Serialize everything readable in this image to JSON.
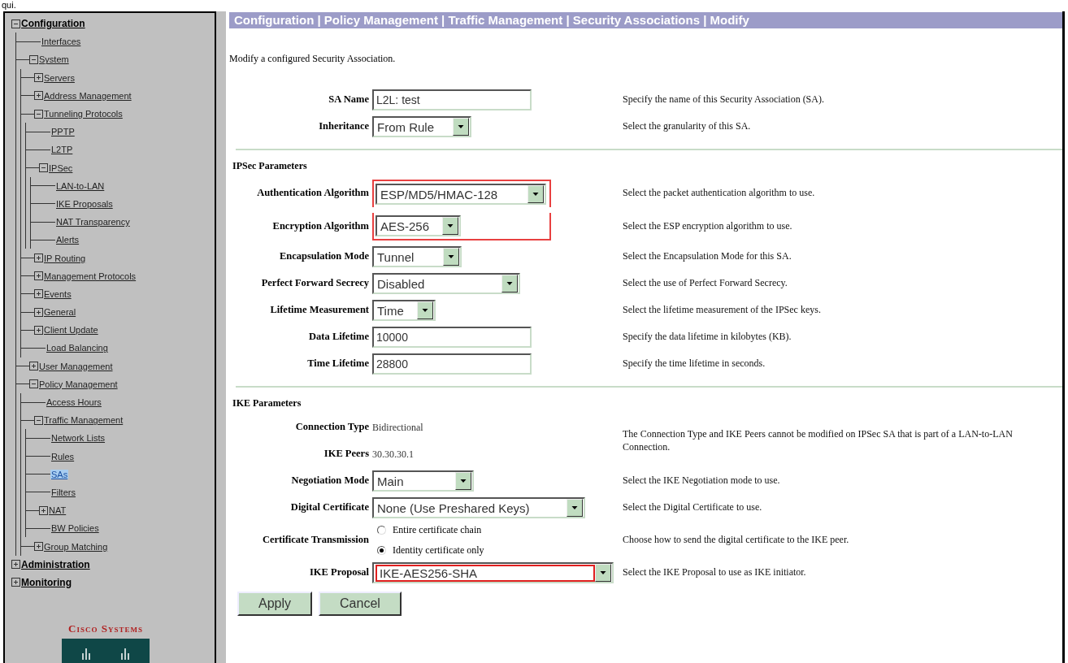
{
  "top_fragment": "qui.",
  "tree": [
    {
      "label": "Configuration",
      "expanded": true,
      "selected": false,
      "children": [
        {
          "label": "Interfaces",
          "selected": false
        },
        {
          "label": "System",
          "expanded": true,
          "selected": false,
          "children": [
            {
              "label": "Servers",
              "expanded": false,
              "selected": false
            },
            {
              "label": "Address Management",
              "expanded": false,
              "selected": false
            },
            {
              "label": "Tunneling Protocols",
              "expanded": true,
              "selected": false,
              "children": [
                {
                  "label": "PPTP",
                  "selected": false
                },
                {
                  "label": "L2TP",
                  "selected": false
                },
                {
                  "label": "IPSec",
                  "expanded": true,
                  "selected": false,
                  "children": [
                    {
                      "label": "LAN-to-LAN",
                      "selected": false
                    },
                    {
                      "label": "IKE Proposals",
                      "selected": false
                    },
                    {
                      "label": "NAT Transparency",
                      "selected": false
                    },
                    {
                      "label": "Alerts",
                      "selected": false
                    }
                  ]
                }
              ]
            },
            {
              "label": "IP Routing",
              "expanded": false,
              "selected": false
            },
            {
              "label": "Management Protocols",
              "expanded": false,
              "selected": false
            },
            {
              "label": "Events",
              "expanded": false,
              "selected": false
            },
            {
              "label": "General",
              "expanded": false,
              "selected": false
            },
            {
              "label": "Client Update",
              "expanded": false,
              "selected": false
            },
            {
              "label": "Load Balancing",
              "selected": false
            }
          ]
        },
        {
          "label": "User Management",
          "expanded": false,
          "selected": false
        },
        {
          "label": "Policy Management",
          "expanded": true,
          "selected": false,
          "children": [
            {
              "label": "Access Hours",
              "selected": false
            },
            {
              "label": "Traffic Management",
              "expanded": true,
              "selected": false,
              "children": [
                {
                  "label": "Network Lists",
                  "selected": false
                },
                {
                  "label": "Rules",
                  "selected": false
                },
                {
                  "label": "SAs",
                  "selected": true
                },
                {
                  "label": "Filters",
                  "selected": false
                },
                {
                  "label": "NAT",
                  "expanded": false,
                  "selected": false
                },
                {
                  "label": "BW Policies",
                  "selected": false
                }
              ]
            },
            {
              "label": "Group Matching",
              "expanded": false,
              "selected": false
            }
          ]
        }
      ]
    },
    {
      "label": "Administration",
      "expanded": false,
      "selected": false
    },
    {
      "label": "Monitoring",
      "expanded": false,
      "selected": false
    }
  ],
  "logo": {
    "text": "Cisco Systems"
  },
  "breadcrumb": "Configuration | Policy Management | Traffic Management | Security Associations | Modify",
  "intro": "Modify a configured Security Association.",
  "sections": [
    {
      "fields": [
        {
          "kind": "text",
          "label": "SA Name",
          "value": "L2L: test",
          "help": "Specify the name of this Security Association (SA)."
        },
        {
          "kind": "select",
          "label": "Inheritance",
          "value": "From Rule",
          "help": "Select the granularity of this SA."
        }
      ]
    },
    {
      "heading": "IPSec Parameters",
      "fields": [
        {
          "kind": "select",
          "label": "Authentication Algorithm",
          "value": "ESP/MD5/HMAC-128",
          "help": "Select the packet authentication algorithm to use.",
          "highlighted": true
        },
        {
          "kind": "select",
          "label": "Encryption Algorithm",
          "value": "AES-256",
          "help": "Select the ESP encryption algorithm to use.",
          "highlighted": true
        },
        {
          "kind": "select",
          "label": "Encapsulation Mode",
          "value": "Tunnel",
          "help": "Select the Encapsulation Mode for this SA."
        },
        {
          "kind": "select",
          "label": "Perfect Forward Secrecy",
          "value": "Disabled",
          "help": "Select the use of Perfect Forward Secrecy."
        },
        {
          "kind": "select",
          "label": "Lifetime Measurement",
          "value": "Time",
          "help": "Select the lifetime measurement of the IPSec keys."
        },
        {
          "kind": "text",
          "label": "Data Lifetime",
          "value": "10000",
          "help": "Specify the data lifetime in kilobytes (KB)."
        },
        {
          "kind": "text",
          "label": "Time Lifetime",
          "value": "28800",
          "help": "Specify the time lifetime in seconds."
        }
      ]
    },
    {
      "heading": "IKE Parameters",
      "fields": [
        {
          "kind": "static",
          "label": "Connection Type",
          "value": "Bidirectional",
          "help": "The Connection Type and IKE Peers cannot be modified on IPSec SA that is part of a LAN-to-LAN Connection."
        },
        {
          "kind": "static",
          "label": "IKE Peers",
          "value": "30.30.30.1"
        },
        {
          "kind": "select",
          "label": "Negotiation Mode",
          "value": "Main",
          "help": "Select the IKE Negotiation mode to use."
        },
        {
          "kind": "select",
          "label": "Digital Certificate",
          "value": "None (Use Preshared Keys)",
          "help": "Select the Digital Certificate to use."
        },
        {
          "kind": "radio",
          "label": "Certificate Transmission",
          "options": [
            {
              "label": "Entire certificate chain",
              "selected": false
            },
            {
              "label": "Identity certificate only",
              "selected": true
            }
          ],
          "help": "Choose how to send the digital certificate to the IKE peer."
        },
        {
          "kind": "select",
          "label": "IKE Proposal",
          "value": "IKE-AES256-SHA",
          "help": "Select the IKE Proposal to use as IKE initiator.",
          "value_highlighted": true
        }
      ]
    }
  ],
  "buttons": [
    "Apply",
    "Cancel"
  ]
}
